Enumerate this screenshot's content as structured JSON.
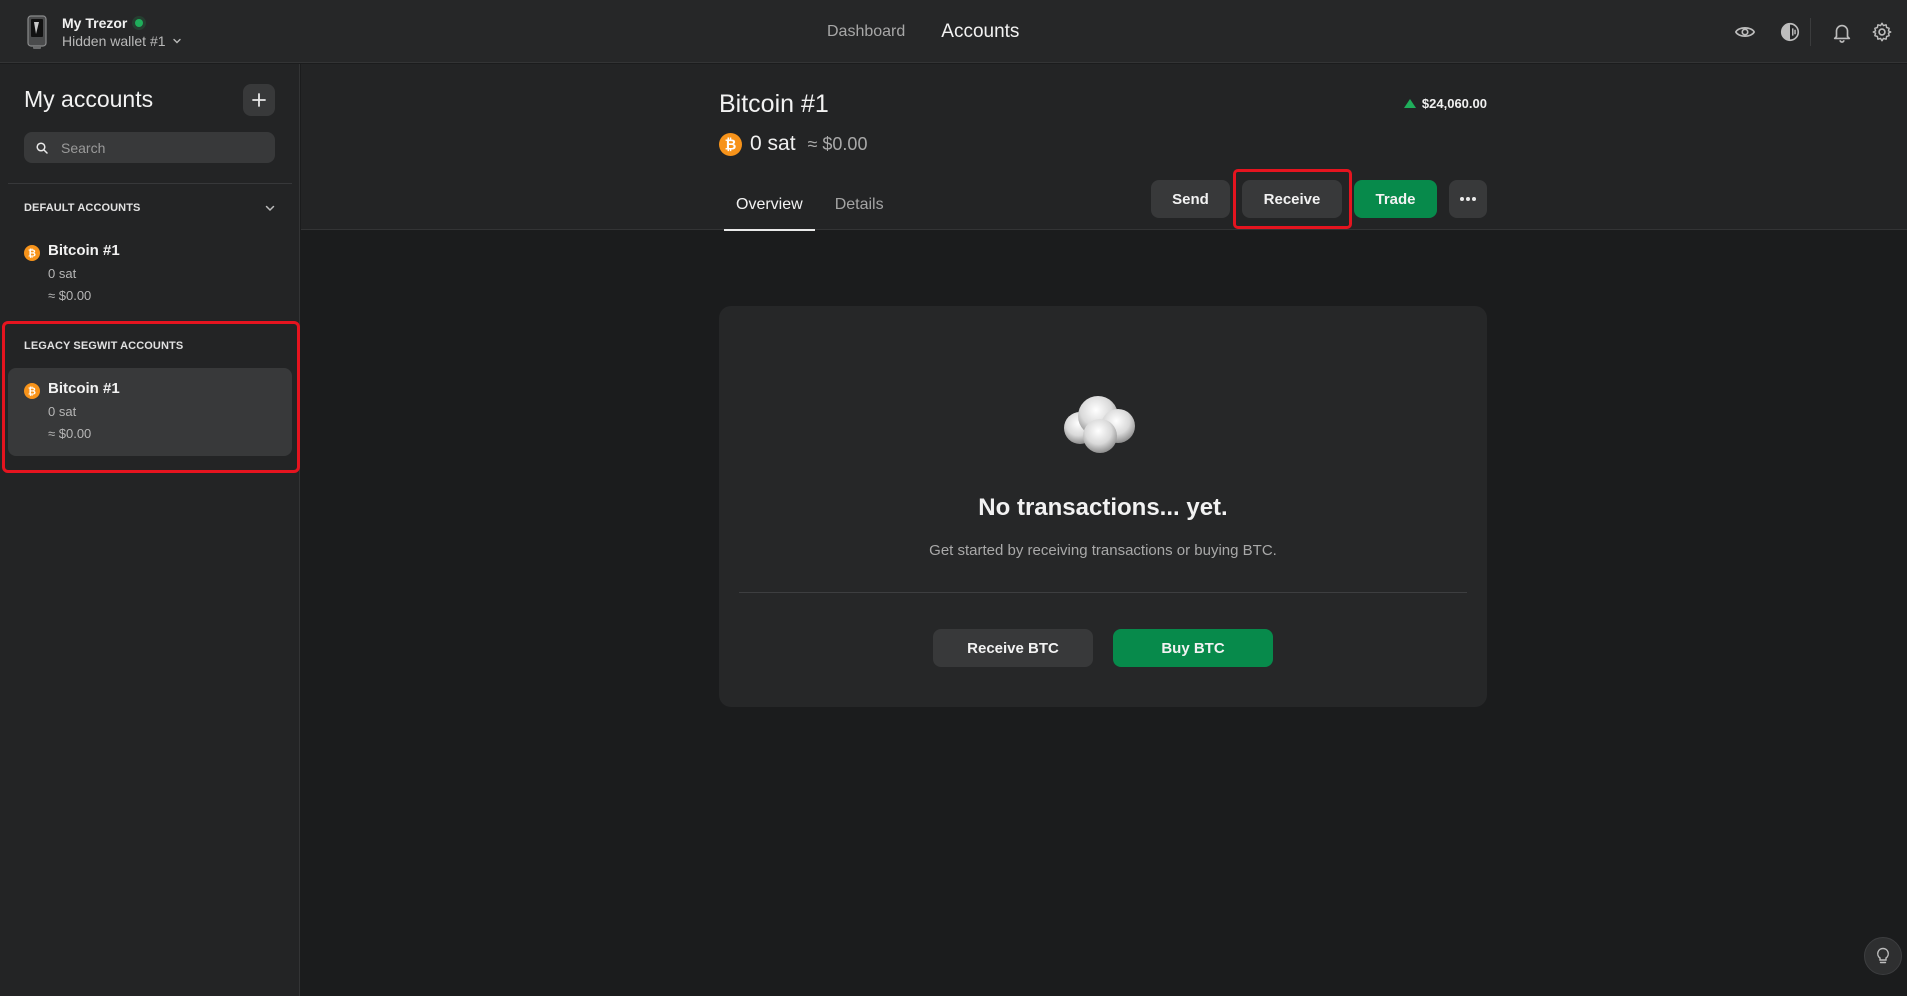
{
  "header": {
    "device_name": "My Trezor",
    "wallet_name": "Hidden wallet #1",
    "nav": [
      {
        "label": "Dashboard",
        "active": false
      },
      {
        "label": "Accounts",
        "active": true
      }
    ],
    "icons": [
      "eye-icon",
      "half-moon-icon",
      "bell-icon",
      "gear-icon"
    ]
  },
  "sidebar": {
    "title": "My accounts",
    "search_placeholder": "Search",
    "groups": [
      {
        "label": "DEFAULT ACCOUNTS",
        "accounts": [
          {
            "name": "Bitcoin #1",
            "balance": "0 sat",
            "fiat": "≈ $0.00",
            "selected": false
          }
        ]
      },
      {
        "label": "LEGACY SEGWIT ACCOUNTS",
        "accounts": [
          {
            "name": "Bitcoin #1",
            "balance": "0 sat",
            "fiat": "≈ $0.00",
            "selected": true
          }
        ]
      }
    ]
  },
  "account": {
    "title": "Bitcoin #1",
    "balance": "0 sat",
    "fiat": "≈ $0.00",
    "price": "$24,060.00",
    "tabs": [
      {
        "label": "Overview",
        "active": true
      },
      {
        "label": "Details",
        "active": false
      }
    ],
    "actions": {
      "send": "Send",
      "receive": "Receive",
      "trade": "Trade"
    }
  },
  "empty_state": {
    "title": "No transactions... yet.",
    "subtitle": "Get started by receiving transactions or buying BTC.",
    "receive_btn": "Receive BTC",
    "buy_btn": "Buy BTC"
  },
  "colors": {
    "background": "#1b1c1d",
    "panel": "#262728",
    "accent_green": "#078a4b",
    "bitcoin_orange": "#f7931a",
    "highlight_red": "#e5141f"
  }
}
